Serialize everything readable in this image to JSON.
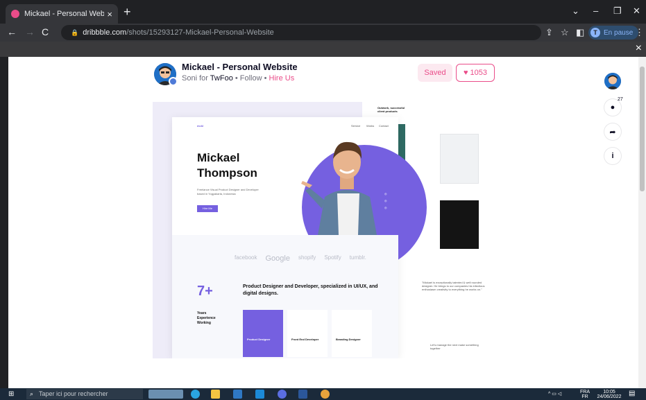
{
  "browser": {
    "tab_title": "Mickael - Personal Website by So",
    "tab_close": "×",
    "new_tab": "+",
    "url_domain": "dribbble.com",
    "url_path": "/shots/15293127-Mickael-Personal-Website",
    "profile_initial": "T",
    "profile_status": "En pause",
    "window_controls": [
      "⌄",
      "–",
      "❐",
      "✕"
    ],
    "overlay_close": "×"
  },
  "shot": {
    "title": "Mickael - Personal Website",
    "author": "Soni",
    "for_word": "for",
    "team": "TwFoo",
    "follow": "Follow",
    "hire": "Hire Us",
    "saved_label": "Saved",
    "likes": "1053",
    "comment_count": "27"
  },
  "preview": {
    "logo": "mckl",
    "nav": [
      "Service",
      "Works",
      "Contact"
    ],
    "name_first": "Mickael",
    "name_last": "Thompson",
    "description": "Freelance Visual Product Designer and Developer based in Yogyakarta, Indonesia",
    "hire_btn": "Hire Me",
    "logos": [
      "facebook",
      "Google",
      "shopify",
      "Spotify",
      "tumblr."
    ],
    "years_value": "7+",
    "years_label": "Years Experience Working",
    "headline": "Product Designer and Developer, specialized in UI/UX, and digital designs.",
    "cards": [
      "Product Designer",
      "Front End Developer",
      "Branding Designer"
    ],
    "right_heading": "Outwork, successful client products",
    "quote": "\"Mickael is exceptionally talented & well rounded designer. He brings to our companies his infectious enthusiasm creativity to everything he works on.\"",
    "footer_snippet": "Let's manage the next make something together"
  },
  "taskbar": {
    "search_placeholder": "Taper ici pour rechercher",
    "lang": "FRA",
    "lang2": "FR",
    "time": "10:05",
    "date": "24/06/2022"
  },
  "colors": {
    "accent": "#ea4c89",
    "preview_purple": "#7560e0"
  }
}
